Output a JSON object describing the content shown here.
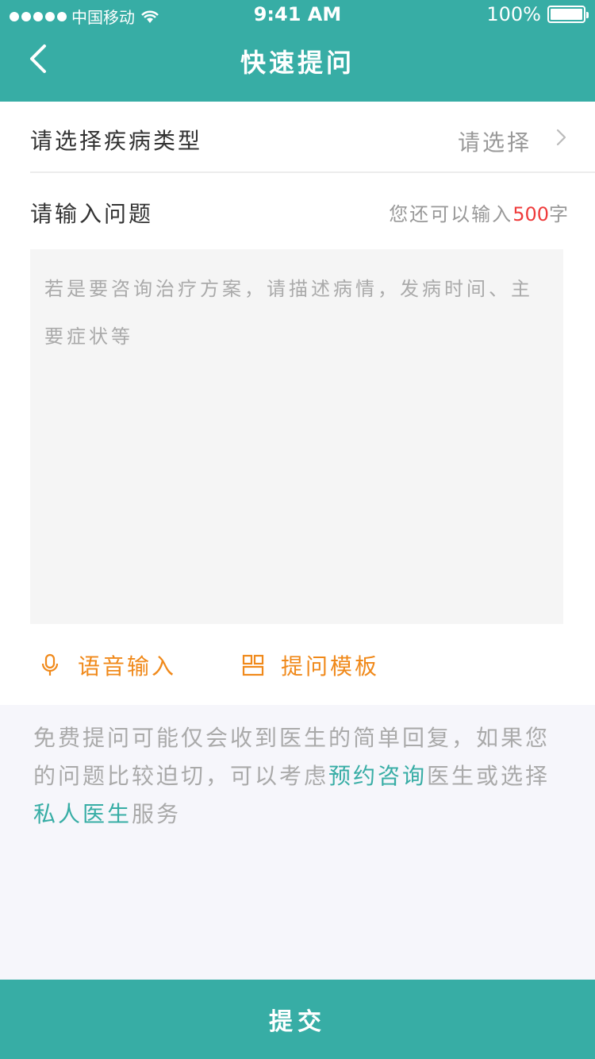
{
  "status_bar": {
    "carrier": "中国移动",
    "time": "9:41 AM",
    "battery": "100%"
  },
  "nav": {
    "title": "快速提问",
    "back_icon": "chevron-left-icon"
  },
  "form": {
    "disease_label": "请选择疾病类型",
    "disease_value": "请选择",
    "question_label": "请输入问题",
    "count_prefix": "您还可以输入",
    "count_number": "500",
    "count_suffix": "字",
    "question_placeholder": "若是要咨询治疗方案，请描述病情，发病时间、主要症状等"
  },
  "tools": {
    "voice_label": "语音输入",
    "voice_icon": "microphone-icon",
    "template_label": "提问模板",
    "template_icon": "template-icon"
  },
  "notice": {
    "part1": "免费提问可能仅会收到医生的简单回复，如果您的问题比较迫切，可以考虑",
    "link1": "预约咨询",
    "part2": "医生或选择",
    "link2": "私人医生",
    "part3": "服务"
  },
  "submit_label": "提交",
  "colors": {
    "primary": "#37ada5",
    "accent": "#f0891a",
    "count_highlight": "#ef3b3b"
  }
}
